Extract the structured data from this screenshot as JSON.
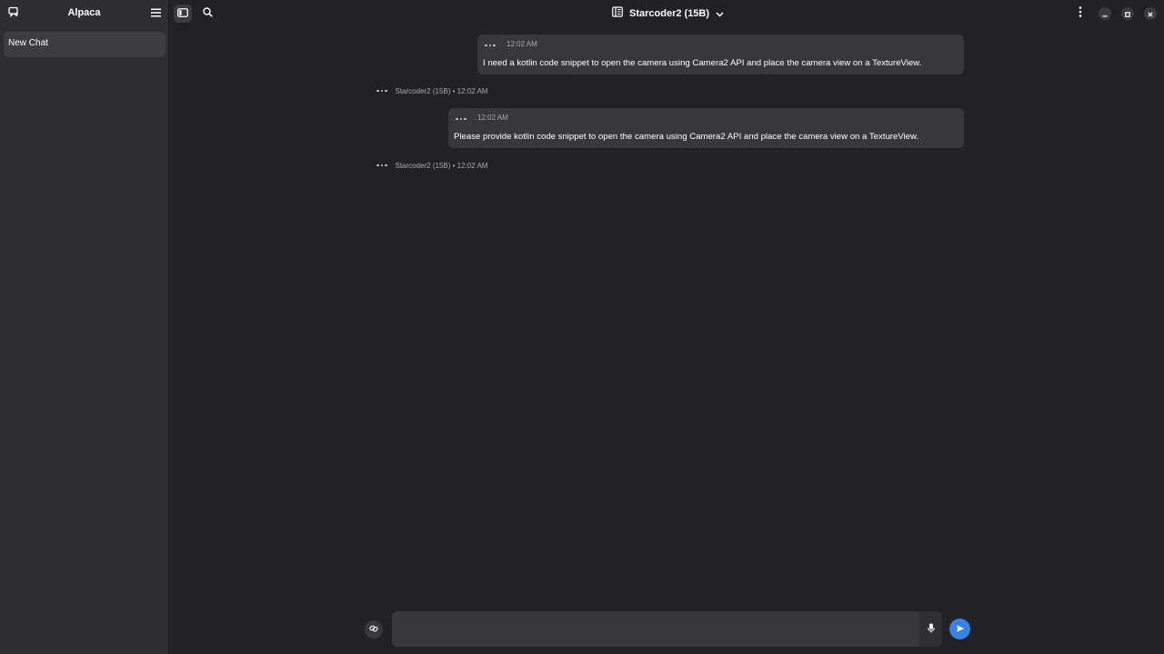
{
  "app": {
    "title": "Alpaca"
  },
  "sidebar": {
    "chats": [
      {
        "label": "New Chat"
      }
    ]
  },
  "header": {
    "model_name": "Starcoder2 (15B)"
  },
  "messages": [
    {
      "role": "user",
      "time": "12:02 AM",
      "text": "I need a kotlin code snippet to open the camera using Camera2 API and place the camera view on a TextureView."
    },
    {
      "role": "assistant",
      "meta": "Starcoder2 (15B) • 12:02 AM"
    },
    {
      "role": "user",
      "time": "12:02 AM",
      "text": "Please provide kotlin code snippet to open the camera using Camera2 API and place the camera view on a TextureView."
    },
    {
      "role": "assistant",
      "meta": "Starcoder2 (15B) • 12:02 AM"
    }
  ],
  "composer": {
    "value": "",
    "placeholder": ""
  },
  "icons": {
    "new_chat": "new-chat-icon",
    "menu": "hamburger-menu-icon",
    "sidebar_toggle": "sidebar-toggle-icon",
    "search": "search-icon",
    "model_manager": "model-manager-icon",
    "dropdown": "chevron-down-icon",
    "more": "vertical-dots-icon",
    "minimize": "minimize-icon",
    "maximize": "maximize-icon",
    "close": "close-icon",
    "message_options": "horizontal-dots-icon",
    "attach": "attachment-icon",
    "microphone": "microphone-icon",
    "send": "send-icon"
  },
  "colors": {
    "background": "#222226",
    "sidebar": "#2e2e32",
    "bubble": "#38383c",
    "accent": "#3584e4"
  }
}
